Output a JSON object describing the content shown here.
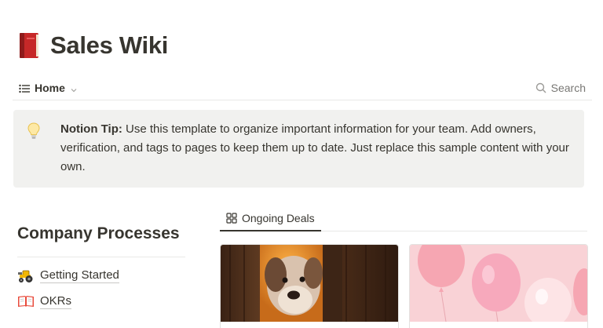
{
  "page": {
    "title": "Sales Wiki",
    "icon": "red-book-icon"
  },
  "view_bar": {
    "view_label": "Home",
    "view_icon": "list-icon",
    "search_label": "Search"
  },
  "callout": {
    "icon": "lightbulb-icon",
    "lead": "Notion Tip:",
    "text": " Use this template to organize important information for your team. Add owners, verification, and tags to pages to keep them up to date. Just replace this sample content with your own."
  },
  "sidebar": {
    "heading": "Company Processes",
    "items": [
      {
        "label": "Getting Started",
        "icon": "tractor-icon"
      },
      {
        "label": "OKRs",
        "icon": "open-book-icon"
      }
    ]
  },
  "gallery": {
    "tab_label": "Ongoing Deals",
    "tab_icon": "gallery-grid-icon",
    "cards": [
      {
        "cover": "puppy-photo",
        "accent": "#5a3a22"
      },
      {
        "cover": "pink-balloons",
        "accent": "#f7c6cc"
      }
    ]
  },
  "colors": {
    "text": "#37352f",
    "muted": "#787774",
    "callout_bg": "#f1f1ef",
    "divider": "#e9e9e7"
  }
}
